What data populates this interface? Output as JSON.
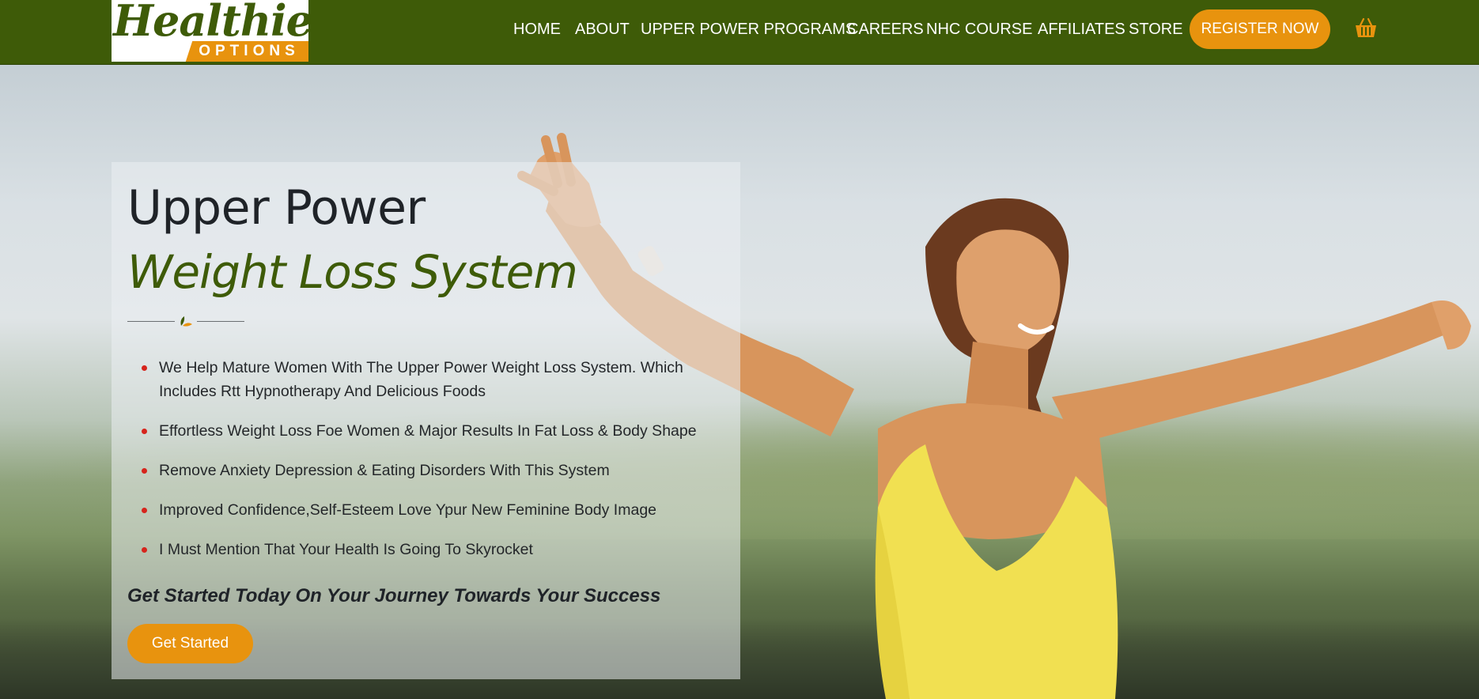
{
  "brand": {
    "logo_script": "Healthier",
    "logo_sub": "OPTIONS"
  },
  "nav": {
    "items": [
      {
        "label": "HOME"
      },
      {
        "label": "ABOUT"
      },
      {
        "label": "UPPER POWER PROGRAMS"
      },
      {
        "label": "CAREERS"
      },
      {
        "label": "NHC COURSE"
      },
      {
        "label": "AFFILIATES"
      },
      {
        "label": "STORE"
      }
    ],
    "register_label": "REGISTER NOW",
    "cart_icon": "basket-icon"
  },
  "hero": {
    "title_line1": "Upper Power",
    "title_line2": "Weight Loss System",
    "divider_icon": "leaf-icon",
    "bullets": [
      "We Help Mature Women With The Upper Power Weight Loss System. Which Includes Rtt Hypnotherapy And Delicious Foods",
      "Effortless Weight Loss Foe Women & Major Results In Fat Loss & Body Shape",
      "Remove Anxiety Depression & Eating Disorders With This System",
      "Improved Confidence,Self-Esteem Love Ypur New Feminine Body Image",
      "I Must Mention That Your Health Is Going To Skyrocket"
    ],
    "cta_text": "Get Started Today On Your Journey Towards Your Success",
    "button_label": "Get Started"
  },
  "colors": {
    "header_bg": "#3e5b08",
    "accent_orange": "#e8930e",
    "title_green": "#3e5b08",
    "bullet_red": "#d6241c"
  }
}
